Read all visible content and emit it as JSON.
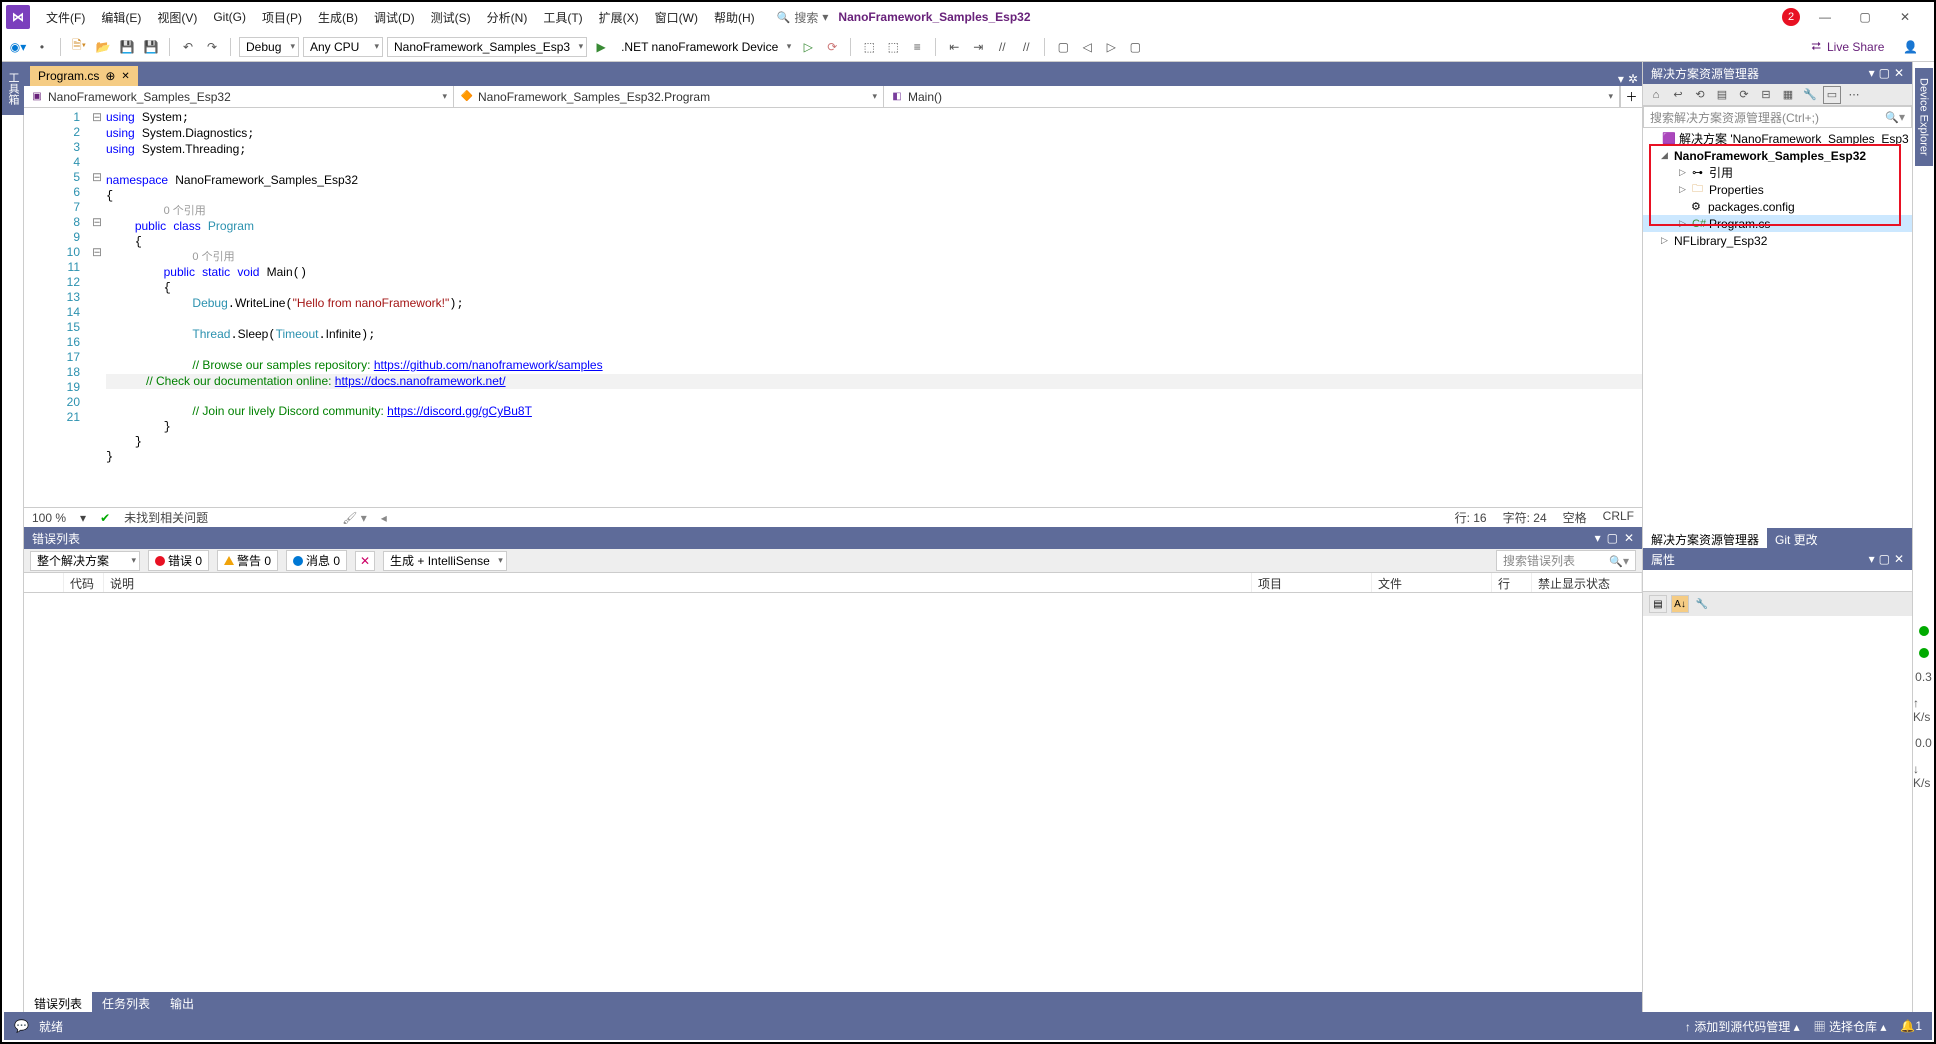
{
  "title": {
    "project": "NanoFramework_Samples_Esp32",
    "search_label": "搜索",
    "badge": "2"
  },
  "menu": [
    "文件(F)",
    "编辑(E)",
    "视图(V)",
    "Git(G)",
    "项目(P)",
    "生成(B)",
    "调试(D)",
    "测试(S)",
    "分析(N)",
    "工具(T)",
    "扩展(X)",
    "窗口(W)",
    "帮助(H)"
  ],
  "toolbar": {
    "config": "Debug",
    "platform": "Any CPU",
    "startup": "NanoFramework_Samples_Esp3",
    "target": ".NET nanoFramework Device",
    "liveshare": "Live Share"
  },
  "left_tab": "工具箱",
  "doc_tab": {
    "name": "Program.cs",
    "pin": "⊕"
  },
  "breadcrumb": {
    "scope": "NanoFramework_Samples_Esp32",
    "class": "NanoFramework_Samples_Esp32.Program",
    "member": "Main()"
  },
  "code": {
    "lines": [
      "1",
      "2",
      "3",
      "4",
      "5",
      "6",
      "7",
      "8",
      "9",
      "10",
      "11",
      "12",
      "13",
      "14",
      "15",
      "16",
      "17",
      "18",
      "19",
      "20",
      "21"
    ],
    "ref_lens": "0 个引用",
    "t": {
      "using": "using",
      "System": "System",
      "Diagnostics": "System.Diagnostics",
      "Threading": "System.Threading",
      "namespace": "namespace",
      "ns": "NanoFramework_Samples_Esp32",
      "public": "public",
      "class": "class",
      "Program": "Program",
      "static": "static",
      "void": "void",
      "Main": "Main",
      "Debug": "Debug",
      "WriteLine": "WriteLine",
      "hello": "\"Hello from nanoFramework!\"",
      "Thread": "Thread",
      "Sleep": "Sleep",
      "Timeout": "Timeout",
      "Infinite": "Infinite",
      "c1": "// Browse our samples repository: ",
      "l1": "https://github.com/nanoframework/samples",
      "c2": "// Check our documentation online: ",
      "l2": "https://docs.nanoframework.net/",
      "c3": "// Join our lively Discord community: ",
      "l3": "https://discord.gg/gCyBu8T"
    }
  },
  "ed_status": {
    "zoom": "100 %",
    "issues": "未找到相关问题",
    "ln": "行: 16",
    "col": "字符: 24",
    "ins": "空格",
    "eol": "CRLF"
  },
  "errlist": {
    "title": "错误列表",
    "scope": "整个解决方案",
    "errors": "错误 0",
    "warnings": "警告 0",
    "messages": "消息 0",
    "mode": "生成 + IntelliSense",
    "search_ph": "搜索错误列表",
    "cols": {
      "code": "代码",
      "desc": "说明",
      "project": "项目",
      "file": "文件",
      "line": "行",
      "supp": "禁止显示状态"
    }
  },
  "bottom_tabs": {
    "err": "错误列表",
    "task": "任务列表",
    "out": "输出"
  },
  "sol": {
    "title": "解决方案资源管理器",
    "search_ph": "搜索解决方案资源管理器(Ctrl+;)",
    "root": "解决方案 'NanoFramework_Samples_Esp3",
    "project": "NanoFramework_Samples_Esp32",
    "refs": "引用",
    "props": "Properties",
    "pkg": "packages.config",
    "prog": "Program.cs",
    "lib": "NFLibrary_Esp32",
    "tabs": {
      "sol": "解决方案资源管理器",
      "git": "Git 更改"
    }
  },
  "props": {
    "title": "属性"
  },
  "right_rail": {
    "tab": "Device Explorer",
    "m1": "0.3",
    "u1": "↑ K/s",
    "m2": "0.0",
    "u2": "↓ K/s"
  },
  "status": {
    "ready": "就绪",
    "src": "添加到源代码管理",
    "repo": "选择仓库",
    "notif": "1"
  }
}
